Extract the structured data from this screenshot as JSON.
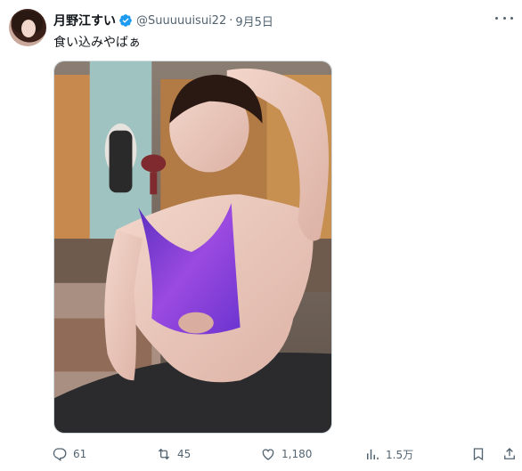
{
  "tweet": {
    "display_name": "月野江すい",
    "handle": "@Suuuuuisui22",
    "separator": "·",
    "date": "9月5日",
    "text": "食い込みやばぁ"
  },
  "actions": {
    "replies": "61",
    "retweets": "45",
    "likes": "1,180",
    "views": "1.5万"
  },
  "colors": {
    "verified": "#1d9bf0",
    "secondary_text": "#536471",
    "swimsuit": "#7b3fd6"
  },
  "icons": {
    "verified": "verified-badge-icon",
    "reply": "reply-icon",
    "retweet": "retweet-icon",
    "like": "like-icon",
    "views": "views-icon",
    "bookmark": "bookmark-icon",
    "share": "share-icon",
    "more": "more-icon"
  }
}
